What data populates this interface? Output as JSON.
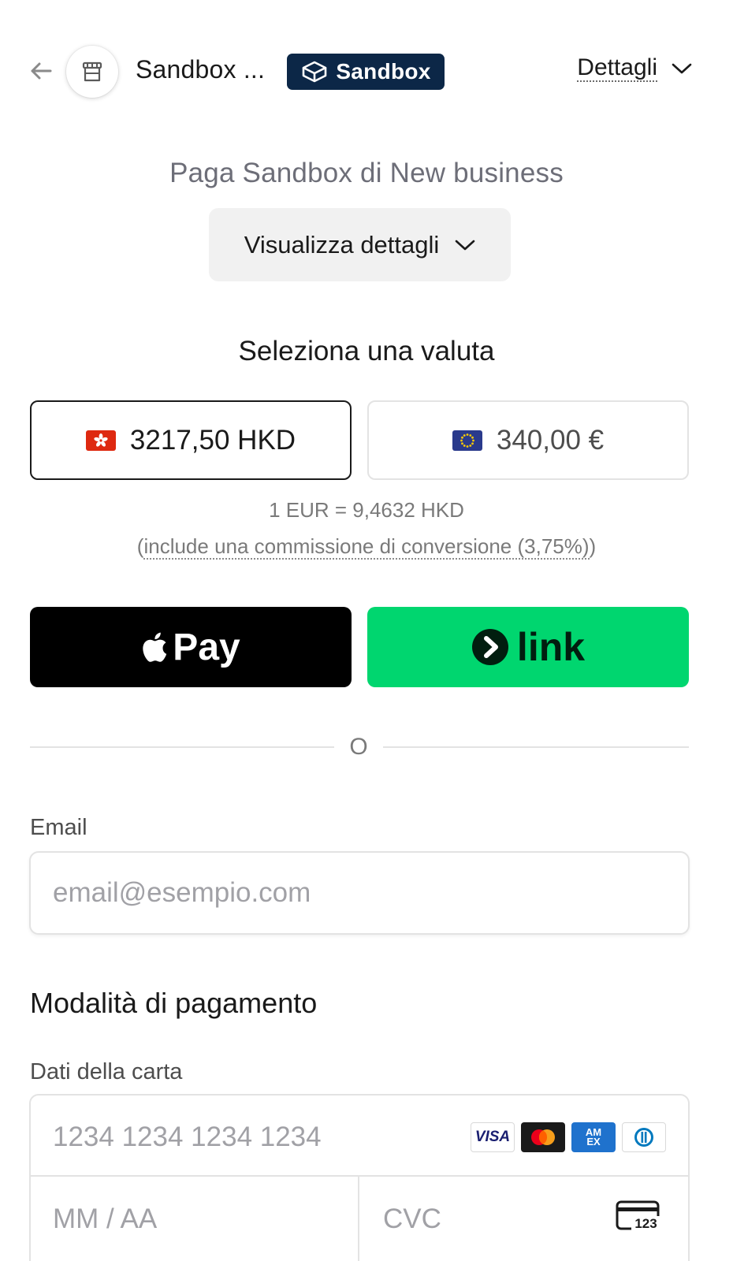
{
  "header": {
    "merchant_name": "Sandbox ...",
    "badge_label": "Sandbox",
    "details_label": "Dettagli"
  },
  "checkout": {
    "title": "Paga Sandbox di New business",
    "view_details_label": "Visualizza dettagli"
  },
  "currency": {
    "heading": "Seleziona una valuta",
    "options": [
      {
        "amount": "3217,50 HKD",
        "flag": "hong-kong-flag",
        "selected": true
      },
      {
        "amount": "340,00 €",
        "flag": "eu-flag",
        "selected": false
      }
    ],
    "rate": "1 EUR = 9,4632 HKD",
    "fee_open": "(",
    "fee_note": "include una commissione di conversione (3,75%)",
    "fee_close": ")"
  },
  "wallets": {
    "apple_pay_label": "Pay",
    "link_label": "link",
    "divider_text": "O"
  },
  "email": {
    "label": "Email",
    "placeholder": "email@esempio.com",
    "value": ""
  },
  "payment": {
    "heading": "Modalità di pagamento",
    "card_label": "Dati della carta",
    "card_number_placeholder": "1234 1234 1234 1234",
    "expiry_placeholder": "MM / AA",
    "cvc_placeholder": "CVC",
    "cvc_icon_text": "123",
    "brands": {
      "visa": "VISA",
      "mastercard": "mastercard",
      "amex_top": "AM",
      "amex_bottom": "EX",
      "diners": "diners"
    }
  },
  "colors": {
    "badge_bg": "#0c2747",
    "link_green": "#00d66f",
    "apple_black": "#000000",
    "border": "#e3e3e3"
  }
}
